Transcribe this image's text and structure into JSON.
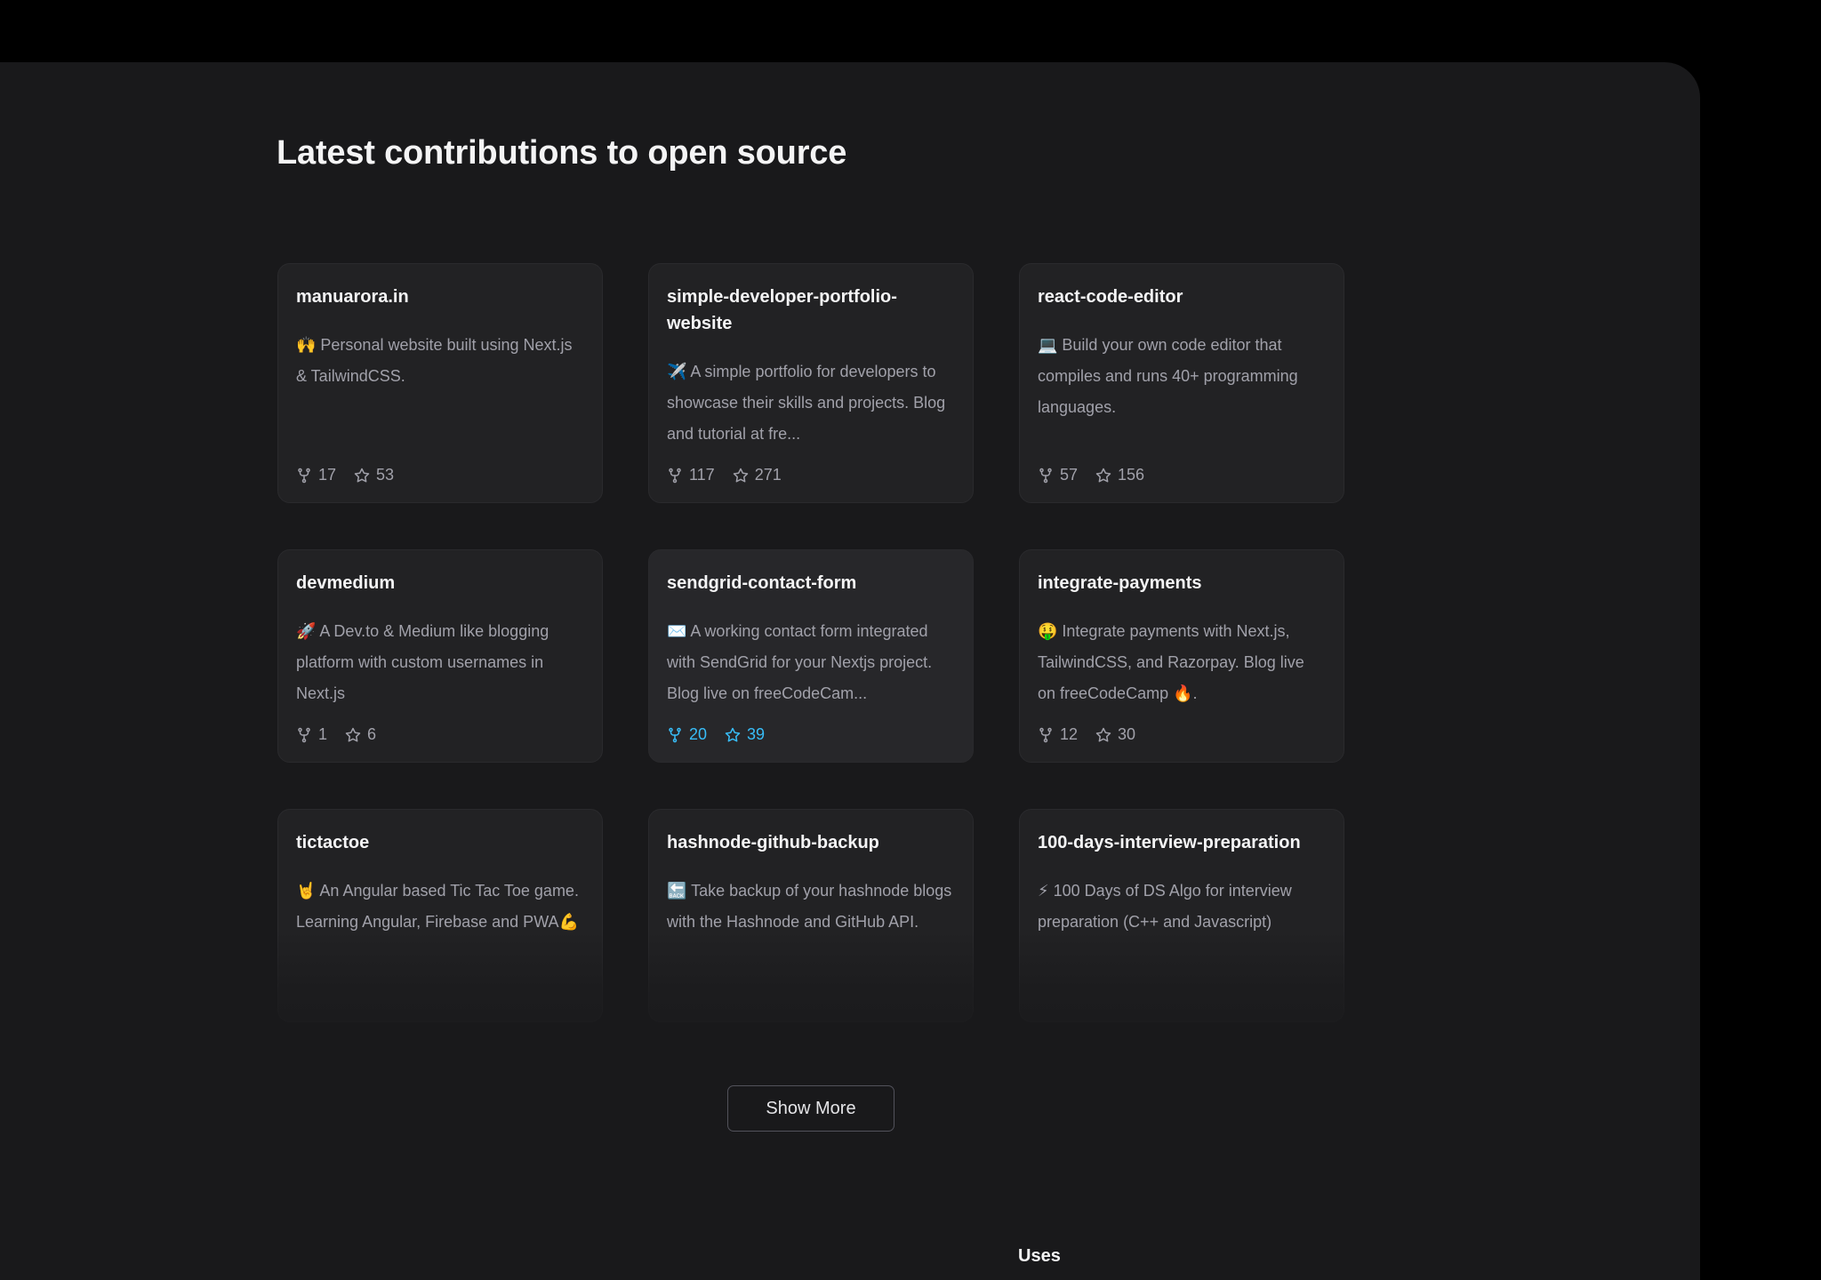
{
  "section": {
    "title": "Latest contributions to open source"
  },
  "repos": [
    {
      "name": "manuarora.in",
      "description": "🙌 Personal website built using Next.js & TailwindCSS.",
      "forks": "17",
      "stars": "53"
    },
    {
      "name": "simple-developer-portfolio-website",
      "description": "✈️ A simple portfolio for developers to showcase their skills and projects. Blog and tutorial at fre...",
      "forks": "117",
      "stars": "271"
    },
    {
      "name": "react-code-editor",
      "description": "💻 Build your own code editor that compiles and runs 40+ programming languages.",
      "forks": "57",
      "stars": "156"
    },
    {
      "name": "devmedium",
      "description": "🚀 A Dev.to & Medium like blogging platform with custom usernames in Next.js",
      "forks": "1",
      "stars": "6"
    },
    {
      "name": "sendgrid-contact-form",
      "description": "✉️ A working contact form integrated with SendGrid for your Nextjs project. Blog live on freeCodeCam...",
      "forks": "20",
      "stars": "39"
    },
    {
      "name": "integrate-payments",
      "description": "🤑 Integrate payments with Next.js, TailwindCSS, and Razorpay. Blog live on freeCodeCamp 🔥.",
      "forks": "12",
      "stars": "30"
    },
    {
      "name": "tictactoe",
      "description": "🤘 An Angular based Tic Tac Toe game. Learning Angular, Firebase and PWA💪",
      "forks": "",
      "stars": ""
    },
    {
      "name": "hashnode-github-backup",
      "description": "🔙 Take backup of your hashnode blogs with the Hashnode and GitHub API.",
      "forks": "",
      "stars": ""
    },
    {
      "name": "100-days-interview-preparation",
      "description": "⚡ 100 Days of DS Algo for interview preparation (C++ and Javascript)",
      "forks": "",
      "stars": ""
    }
  ],
  "actions": {
    "show_more": "Show More"
  },
  "footer": {
    "uses": "Uses"
  },
  "colors": {
    "background": "#000000",
    "panel": "#19191b",
    "card": "#222224",
    "accent_active": "#38bdf8"
  }
}
